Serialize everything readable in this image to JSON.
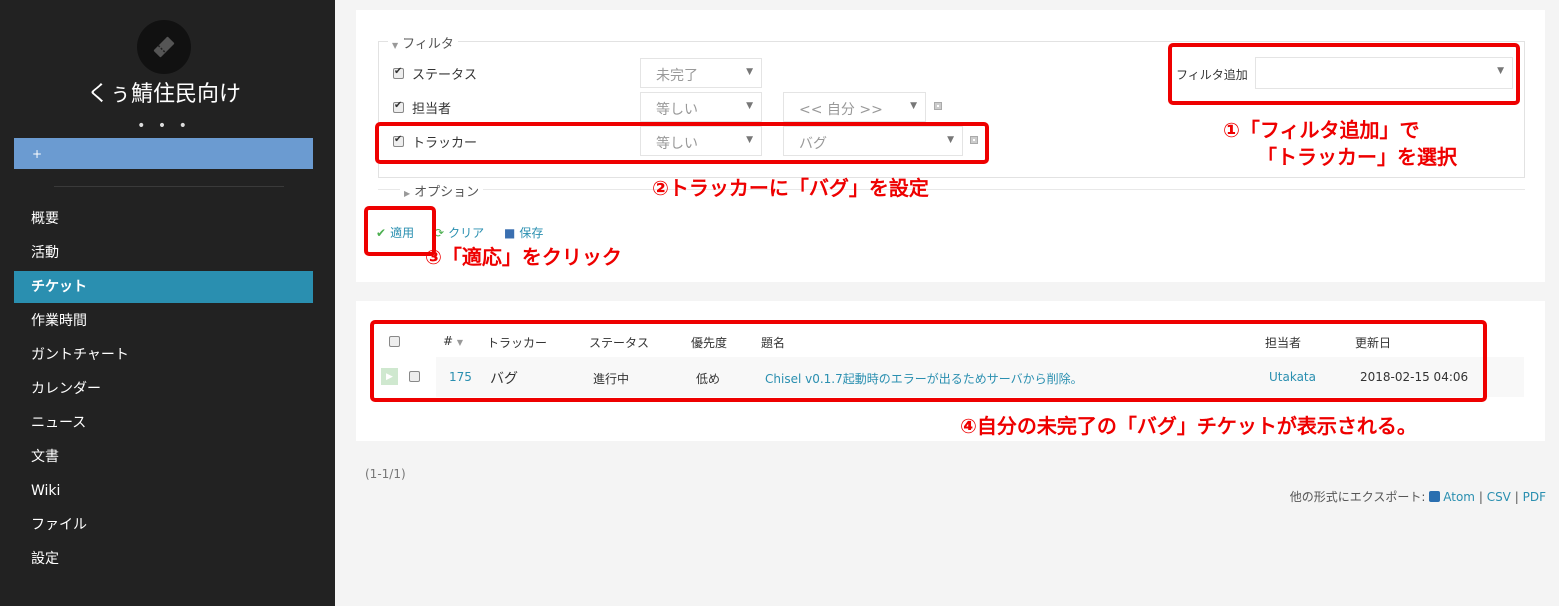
{
  "sidebar": {
    "project_name": "くぅ鯖住民向け",
    "dots": "• • •",
    "add_button": "+",
    "items": [
      {
        "label": "概要"
      },
      {
        "label": "活動"
      },
      {
        "label": "チケット",
        "active": true
      },
      {
        "label": "作業時間"
      },
      {
        "label": "ガントチャート"
      },
      {
        "label": "カレンダー"
      },
      {
        "label": "ニュース"
      },
      {
        "label": "文書"
      },
      {
        "label": "Wiki"
      },
      {
        "label": "ファイル"
      },
      {
        "label": "設定"
      }
    ]
  },
  "filters": {
    "legend": "フィルタ",
    "rows": [
      {
        "label": "ステータス",
        "checked": true,
        "operator": "未完了"
      },
      {
        "label": "担当者",
        "checked": true,
        "operator": "等しい",
        "value": "<< 自分 >>"
      },
      {
        "label": "トラッカー",
        "checked": true,
        "operator": "等しい",
        "value": "バグ"
      }
    ],
    "add_filter_label": "フィルタ追加",
    "add_filter_value": ""
  },
  "options": {
    "legend": "オプション"
  },
  "actions": {
    "apply": "適用",
    "clear": "クリア",
    "save": "保存"
  },
  "table": {
    "headers": {
      "id": "#",
      "tracker": "トラッカー",
      "status": "ステータス",
      "priority": "優先度",
      "subject": "題名",
      "assignee": "担当者",
      "updated": "更新日"
    },
    "rows": [
      {
        "id": "175",
        "tracker": "バグ",
        "status": "進行中",
        "priority": "低め",
        "subject": "Chisel v0.1.7起動時のエラーが出るためサーバから削除。",
        "assignee": "Utakata",
        "updated": "2018-02-15 04:06"
      }
    ]
  },
  "pager": "(1-1/1)",
  "export": {
    "label": "他の形式にエクスポート:",
    "atom": "Atom",
    "csv": "CSV",
    "pdf": "PDF",
    "sep": "|"
  },
  "annotations": {
    "a1_line1": "①「フィルタ追加」で",
    "a1_line2": "「トラッカー」を選択",
    "a2": "②トラッカーに「バグ」を設定",
    "a3": "③「適応」をクリック",
    "a4": "④自分の未完了の「バグ」チケットが表示される。",
    "color": "#e00000"
  },
  "colors": {
    "sidebar_bg": "#222222",
    "active_nav": "#2a8fb0",
    "add_button": "#6b9bd1",
    "link": "#2a8fb0"
  }
}
